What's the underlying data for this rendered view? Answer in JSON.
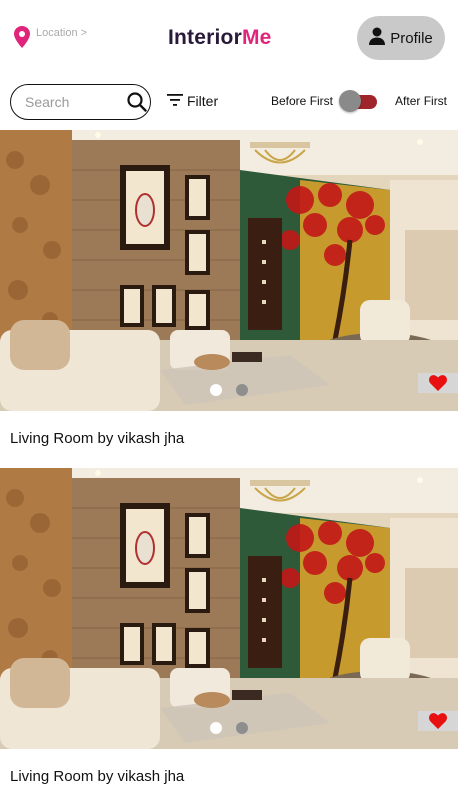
{
  "header": {
    "location_label": "Location >",
    "brand_part1": "Interior",
    "brand_part2": "Me",
    "profile_label": "Profile"
  },
  "toolbar": {
    "search_placeholder": "Search",
    "filter_label": "Filter",
    "before_label": "Before First",
    "after_label": "After First",
    "toggle_state": "before"
  },
  "colors": {
    "accent": "#e0247a",
    "toggle_track": "#a0252b",
    "heart": "#e81010"
  },
  "icons": [
    "location-pin-icon",
    "user-icon",
    "search-icon",
    "filter-icon",
    "heart-icon"
  ],
  "cards": [
    {
      "title": "Living Room by vikash jha",
      "slides": 2,
      "active_slide": 1,
      "favorited": true
    },
    {
      "title": "Living Room by vikash jha",
      "slides": 2,
      "active_slide": 1,
      "favorited": true
    }
  ]
}
